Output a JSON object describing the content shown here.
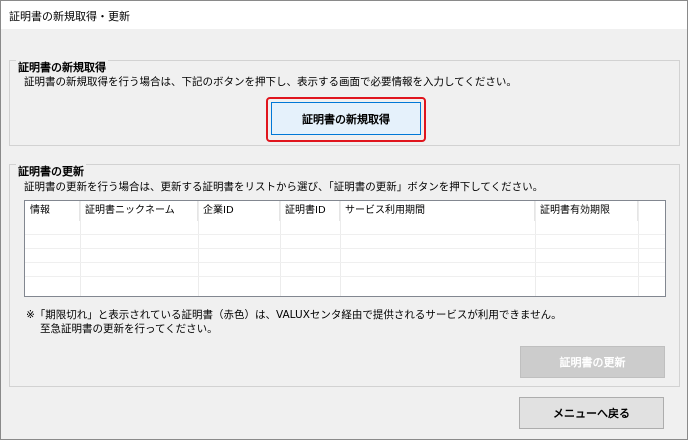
{
  "window": {
    "title": "証明書の新規取得・更新"
  },
  "new_section": {
    "title": "証明書の新規取得",
    "description": "証明書の新規取得を行う場合は、下記のボタンを押下し、表示する画面で必要情報を入力してください。",
    "button_label": "証明書の新規取得"
  },
  "renew_section": {
    "title": "証明書の更新",
    "description": "証明書の更新を行う場合は、更新する証明書をリストから選び、「証明書の更新」ボタンを押下してください。",
    "table": {
      "columns": [
        "情報",
        "証明書ニックネーム",
        "企業ID",
        "証明書ID",
        "サービス利用期間",
        "証明書有効期限"
      ],
      "rows": []
    },
    "note_line1": "※「期限切れ」と表示されている証明書（赤色）は、VALUXセンタ経由で提供されるサービスが利用できません。",
    "note_line2": "至急証明書の更新を行ってください。",
    "button_label": "証明書の更新"
  },
  "footer": {
    "back_button_label": "メニューへ戻る"
  },
  "colors": {
    "highlight": "#e0151d",
    "primary_border": "#0078d7",
    "background": "#f0f0f0"
  }
}
